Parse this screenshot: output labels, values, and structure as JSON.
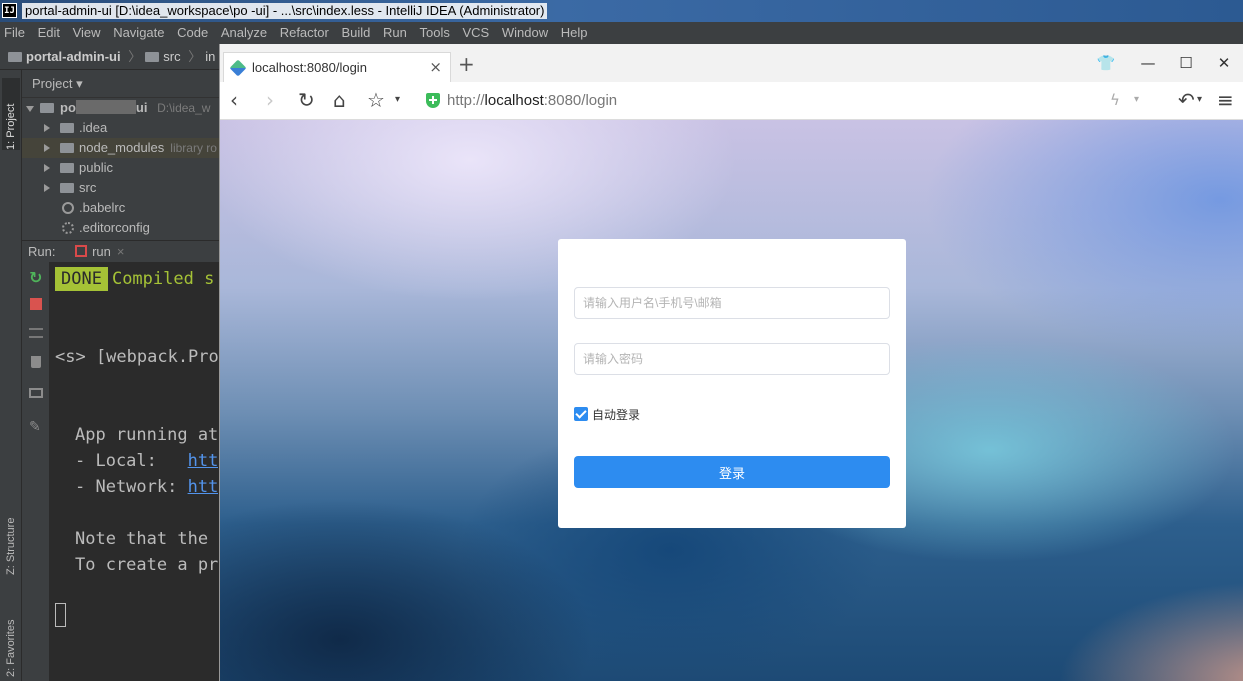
{
  "ide": {
    "window_title": "portal-admin-ui [D:\\idea_workspace\\po        -ui] - ...\\src\\index.less - IntelliJ IDEA (Administrator)",
    "logo_text": "IJ",
    "menu": [
      "File",
      "Edit",
      "View",
      "Navigate",
      "Code",
      "Analyze",
      "Refactor",
      "Build",
      "Run",
      "Tools",
      "VCS",
      "Window",
      "Help"
    ],
    "breadcrumb": {
      "project": "portal-admin-ui",
      "folder": "src",
      "file": "in"
    },
    "left_tabs": {
      "project": "1: Project",
      "structure": "Z: Structure",
      "favorites": "2: Favorites"
    },
    "project_panel": {
      "title": "Project",
      "root": {
        "name": "po",
        "suffix": "ui",
        "path": "D:\\idea_w"
      },
      "items": [
        {
          "name": ".idea",
          "type": "folder"
        },
        {
          "name": "node_modules",
          "hint": "library ro",
          "type": "folder"
        },
        {
          "name": "public",
          "type": "folder"
        },
        {
          "name": "src",
          "type": "folder"
        },
        {
          "name": ".babelrc",
          "type": "file"
        },
        {
          "name": ".editorconfig",
          "type": "file"
        }
      ]
    },
    "run_panel": {
      "label": "Run:",
      "tab": "run",
      "console": {
        "done": "DONE",
        "compiled": "Compiled s",
        "webpack": "<s> [webpack.Prog",
        "app_running": "App running at",
        "local_label": "- Local:   ",
        "local_link": "http",
        "network_label": "- Network: ",
        "network_link": "http",
        "note": "Note that the d",
        "create": "To create a pro"
      }
    }
  },
  "browser": {
    "tab_title": "localhost:8080/login",
    "url_prefix": "http://",
    "url_host": "localhost",
    "url_rest": ":8080/login",
    "login": {
      "username_placeholder": "请输入用户名\\手机号\\邮箱",
      "password_placeholder": "请输入密码",
      "remember_label": "自动登录",
      "remember_checked": true,
      "submit_label": "登录",
      "accent_color": "#2d8cf0"
    }
  }
}
